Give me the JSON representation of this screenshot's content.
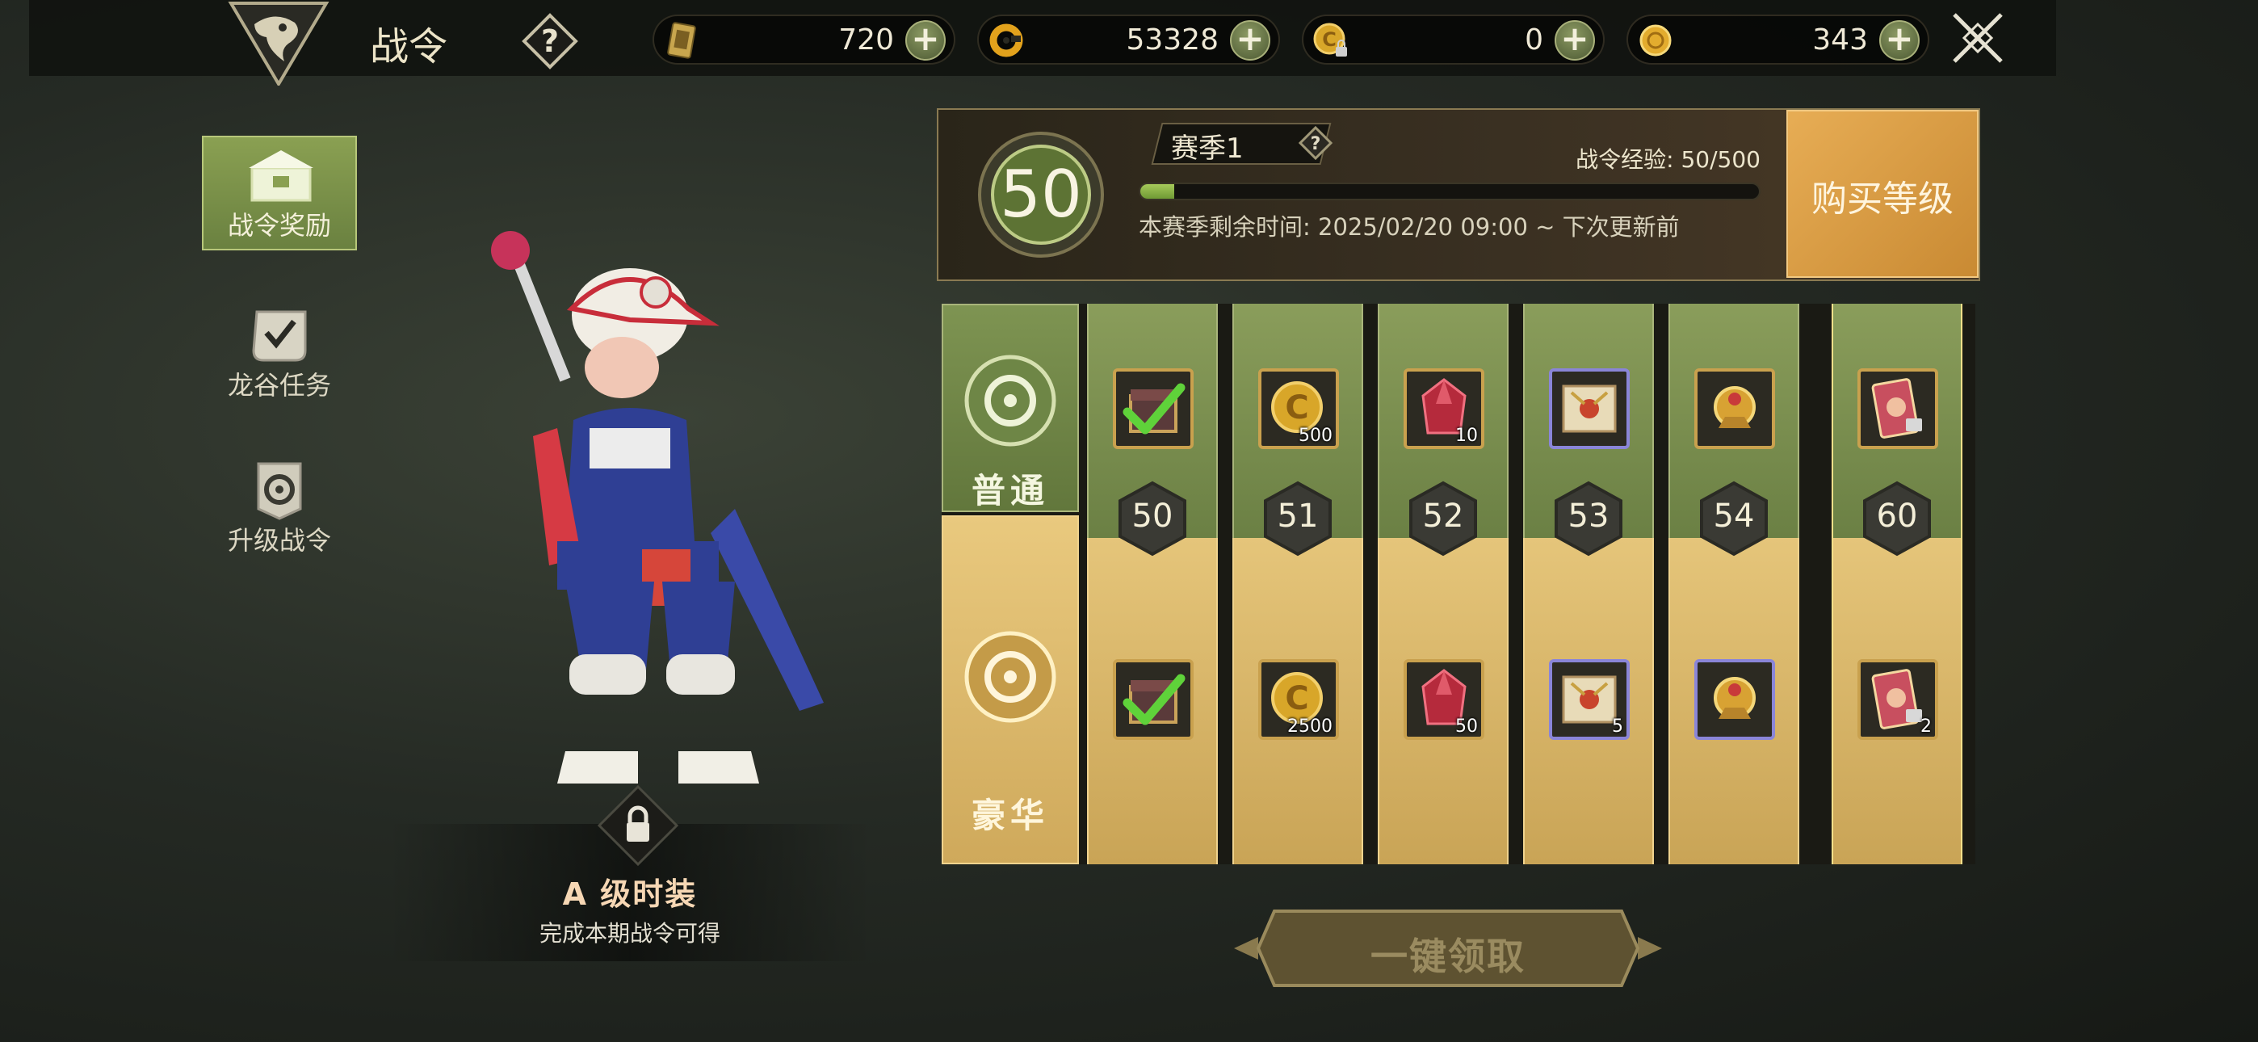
{
  "header": {
    "title": "战令"
  },
  "currencies": [
    {
      "icon": "card-ticket-icon",
      "value": "720"
    },
    {
      "icon": "gold-ring-coin-icon",
      "value": "53328"
    },
    {
      "icon": "locked-coin-icon",
      "value": "0"
    },
    {
      "icon": "gold-coin-icon",
      "value": "343"
    }
  ],
  "sidebar": {
    "items": [
      {
        "label": "战令奖励",
        "active": true
      },
      {
        "label": "龙谷任务",
        "active": false
      },
      {
        "label": "升级战令",
        "active": false
      }
    ]
  },
  "showcase": {
    "title": "A 级时装",
    "subtitle": "完成本期战令可得"
  },
  "season": {
    "level": "50",
    "name": "赛季1",
    "exp_text": "战令经验: 50/500",
    "exp_progress": 0.055,
    "remaining": "本赛季剩余时间: 2025/02/20 09:00 ~ 下次更新前",
    "buy_label": "购买等级"
  },
  "tiers": {
    "normal": "普通",
    "deluxe": "豪华"
  },
  "rewards": [
    {
      "level": "50",
      "normal": {
        "icon": "loot-chest-icon",
        "qty": "",
        "claimed": true
      },
      "deluxe": {
        "icon": "loot-chest-icon",
        "qty": "",
        "claimed": true
      }
    },
    {
      "level": "51",
      "normal": {
        "icon": "locked-coin-icon",
        "qty": "500"
      },
      "deluxe": {
        "icon": "locked-coin-icon",
        "qty": "2500"
      }
    },
    {
      "level": "52",
      "normal": {
        "icon": "red-crystal-icon",
        "qty": "10"
      },
      "deluxe": {
        "icon": "red-crystal-icon",
        "qty": "50"
      }
    },
    {
      "level": "53",
      "normal": {
        "icon": "scroll-map-icon",
        "qty": ""
      },
      "deluxe": {
        "icon": "scroll-map-icon",
        "qty": "5"
      }
    },
    {
      "level": "54",
      "normal": {
        "icon": "gold-emblem-icon",
        "qty": ""
      },
      "deluxe": {
        "icon": "gold-emblem-icon",
        "qty": ""
      }
    },
    {
      "level": "60",
      "normal": {
        "icon": "locked-card-icon",
        "qty": ""
      },
      "deluxe": {
        "icon": "locked-card-icon",
        "qty": "2"
      }
    }
  ],
  "claim_all": "一键领取",
  "colors": {
    "accent_green": "#8aa052",
    "accent_gold": "#e5c57a",
    "buy_orange": "#d99a42"
  }
}
